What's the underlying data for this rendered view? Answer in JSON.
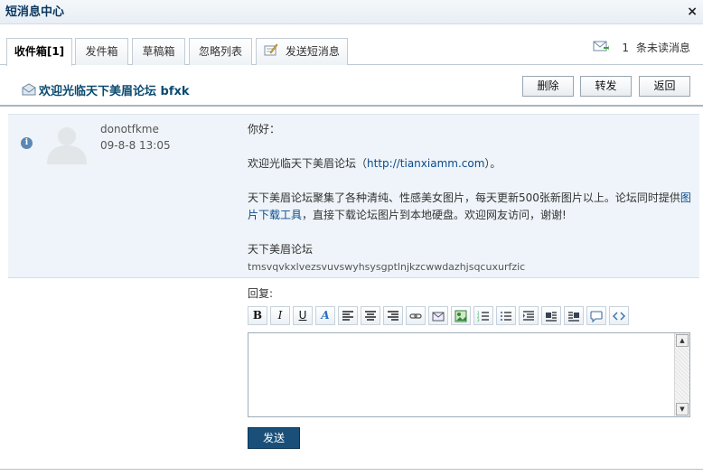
{
  "window": {
    "title": "短消息中心",
    "close_label": "×"
  },
  "tabs": [
    {
      "label": "收件箱[1]",
      "active": true
    },
    {
      "label": "发件箱",
      "active": false
    },
    {
      "label": "草稿箱",
      "active": false
    },
    {
      "label": "忽略列表",
      "active": false
    },
    {
      "label": "发送短消息",
      "active": false,
      "icon": "compose-icon"
    }
  ],
  "unread": {
    "count": "1",
    "label": "条未读消息",
    "icon": "mail-icon"
  },
  "message_header": {
    "subject": "欢迎光临天下美眉论坛 bfxk",
    "icon": "envelope-icon",
    "buttons": {
      "delete": "删除",
      "forward": "转发",
      "back": "返回"
    }
  },
  "message": {
    "sender": "donotfkme",
    "time": "09-8-8 13:05",
    "info_icon": "info-icon",
    "avatar_icon": "default-avatar-icon",
    "greeting": "你好：",
    "line1_prefix": "欢迎光临天下美眉论坛（",
    "line1_link": "http://tianxiamm.com",
    "line1_suffix": "）。",
    "line2_prefix": "天下美眉论坛聚集了各种清纯、性感美女图片，每天更新500张新图片以上。论坛同时提供",
    "line2_link": "图片下载工具",
    "line2_suffix": "，直接下载论坛图片到本地硬盘。欢迎网友访问，谢谢!",
    "signature_title": "天下美眉论坛",
    "signature_text": "tmsvqvkxlvezsvuvswyhsysgptlnjkzcwwdazhjsqcuxurfzic"
  },
  "reply": {
    "label": "回复:",
    "send_label": "发送",
    "toolbar": [
      "bold",
      "italic",
      "underline",
      "font-color",
      "align-left",
      "align-center",
      "align-right",
      "link",
      "image",
      "insert-image",
      "ordered-list",
      "unordered-list",
      "indent",
      "float-left",
      "float-right",
      "quote",
      "code"
    ]
  },
  "colors": {
    "accent": "#1a4f79",
    "title": "#09375f",
    "link": "#0b4a8a",
    "message_bg": "#eef4f9"
  }
}
